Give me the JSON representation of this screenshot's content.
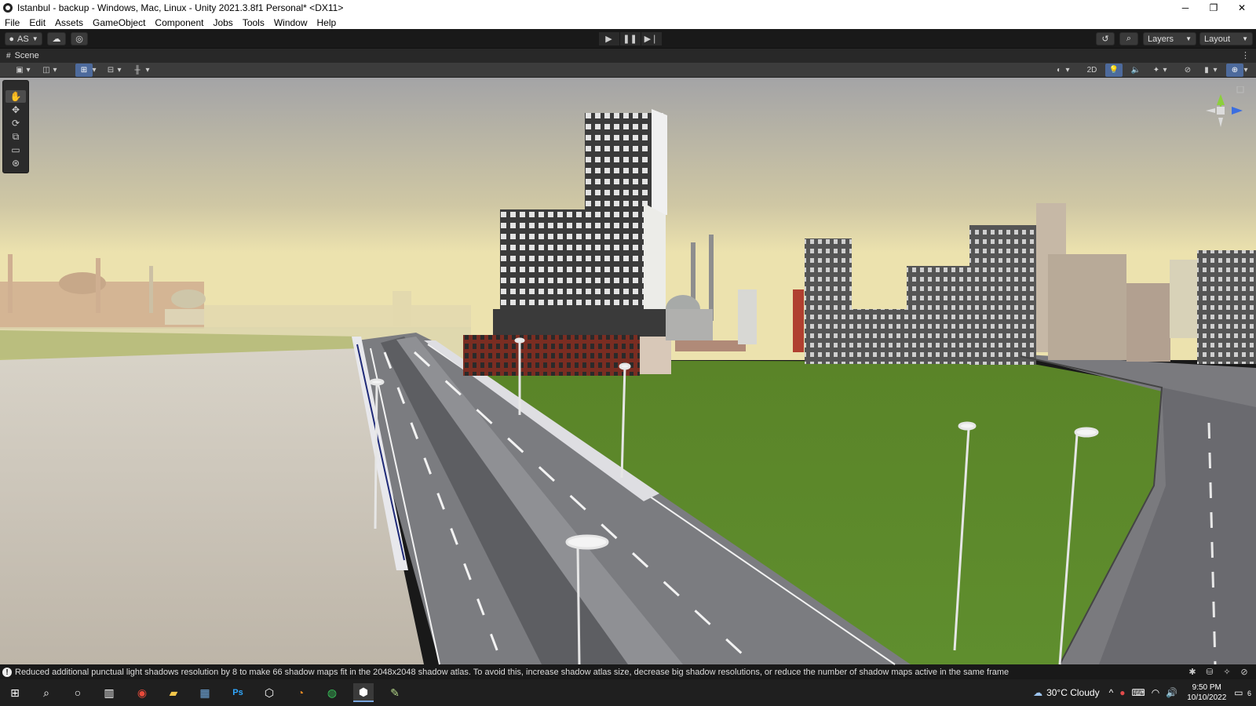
{
  "window": {
    "title": "Istanbul - backup - Windows, Mac, Linux - Unity 2021.3.8f1 Personal* <DX11>",
    "minimize": "─",
    "maximize": "❐",
    "close": "✕"
  },
  "menu": {
    "items": [
      "File",
      "Edit",
      "Assets",
      "GameObject",
      "Component",
      "Jobs",
      "Tools",
      "Window",
      "Help"
    ]
  },
  "toolbar": {
    "account_label": "AS",
    "layers_label": "Layers",
    "layout_label": "Layout"
  },
  "scene_tab": {
    "label": "Scene",
    "more": "⋮"
  },
  "scene_toolbar": {
    "mode_2d_label": "2D"
  },
  "status": {
    "message": "Reduced additional punctual light shadows resolution by 8 to make 66 shadow maps fit in the 2048x2048 shadow atlas. To avoid this, increase shadow atlas size, decrease big shadow resolutions, or reduce the number of shadow maps active in the same frame"
  },
  "taskbar": {
    "weather": "30°C  Cloudy",
    "time": "9:50 PM",
    "date": "10/10/2022",
    "notification_count": "6"
  },
  "colors": {
    "sky_top": "#a8a8a8",
    "sky_horizon": "#e6dba6",
    "grass": "#5f8a2e",
    "sand": "#cdc6bb",
    "road": "#6b6b70",
    "accent": "#4d6a9c"
  }
}
